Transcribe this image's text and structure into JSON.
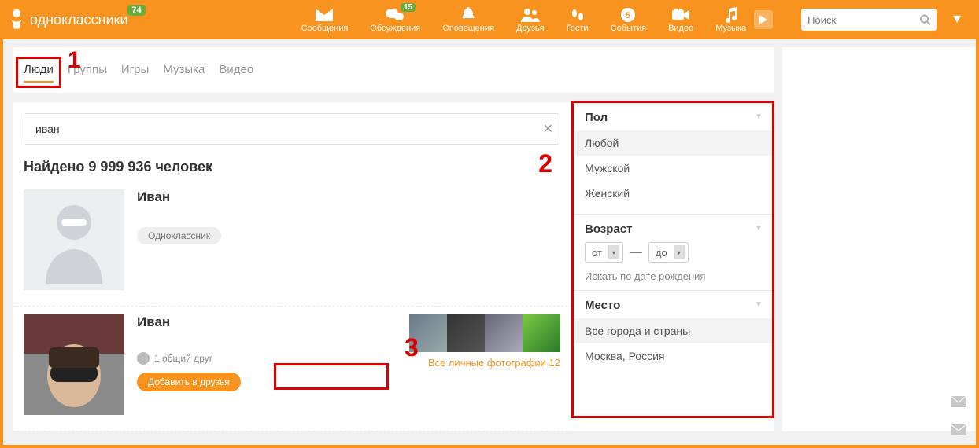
{
  "site_name": "одноклассники",
  "badge_main": "74",
  "toolbar": [
    {
      "id": "messages",
      "label": "Сообщения"
    },
    {
      "id": "discussions",
      "label": "Обсуждения",
      "badge": "15"
    },
    {
      "id": "alerts",
      "label": "Оповещения"
    },
    {
      "id": "friends",
      "label": "Друзья"
    },
    {
      "id": "guests",
      "label": "Гости"
    },
    {
      "id": "events",
      "label": "События"
    },
    {
      "id": "video",
      "label": "Видео"
    },
    {
      "id": "music",
      "label": "Музыка"
    }
  ],
  "search_placeholder": "Поиск",
  "tabs": [
    {
      "label": "Люди",
      "active": true
    },
    {
      "label": "Группы"
    },
    {
      "label": "Игры"
    },
    {
      "label": "Музыка"
    },
    {
      "label": "Видео"
    }
  ],
  "query": "иван",
  "results_heading": "Найдено 9 999 936 человек",
  "markers": {
    "m1": "1",
    "m2": "2",
    "m3": "3"
  },
  "result1": {
    "name": "Иван",
    "tag": "Одноклассник"
  },
  "result2": {
    "name": "Иван",
    "mutual": "1 общий друг",
    "add_button": "Добавить в друзья",
    "photos_link": "Все личные фотографии 12"
  },
  "filters": {
    "gender": {
      "title": "Пол",
      "options": [
        "Любой",
        "Мужской",
        "Женский"
      ],
      "selected_idx": 0
    },
    "age": {
      "title": "Возраст",
      "from": "от",
      "to": "до",
      "dash": "—",
      "dob_link": "Искать по дате рождения"
    },
    "place": {
      "title": "Место",
      "options": [
        "Все города и страны",
        "Москва, Россия"
      ],
      "selected_idx": 0
    }
  }
}
